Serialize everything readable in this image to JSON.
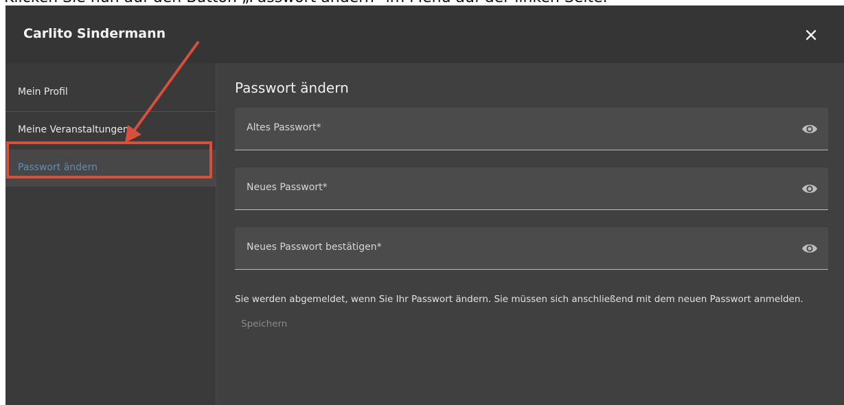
{
  "top_strip": {
    "text": "Klicken Sie nun auf den Button „Passwort ändern“ im Menü auf der linken Seite."
  },
  "dialog": {
    "title": "Carlito Sindermann"
  },
  "sidebar": {
    "items": [
      {
        "label": "Mein Profil"
      },
      {
        "label": "Meine Veranstaltungen"
      },
      {
        "label": "Passwort ändern"
      }
    ]
  },
  "main": {
    "title": "Passwort ändern",
    "fields": [
      {
        "label": "Altes Passwort*",
        "icon": "eye-icon"
      },
      {
        "label": "Neues Passwort*",
        "icon": "eye-icon"
      },
      {
        "label": "Neues Passwort bestätigen*",
        "icon": "eye-icon"
      }
    ],
    "info_text": "Sie werden abgemeldet, wenn Sie Ihr Passwort ändern. Sie müssen sich anschließend mit dem neuen Passwort anmelden.",
    "save_label": "Speichern"
  },
  "colors": {
    "annotation": "#d8503a",
    "active_nav": "#5a8fb8",
    "dialog_bg": "#404040",
    "header_bg": "#353535"
  }
}
